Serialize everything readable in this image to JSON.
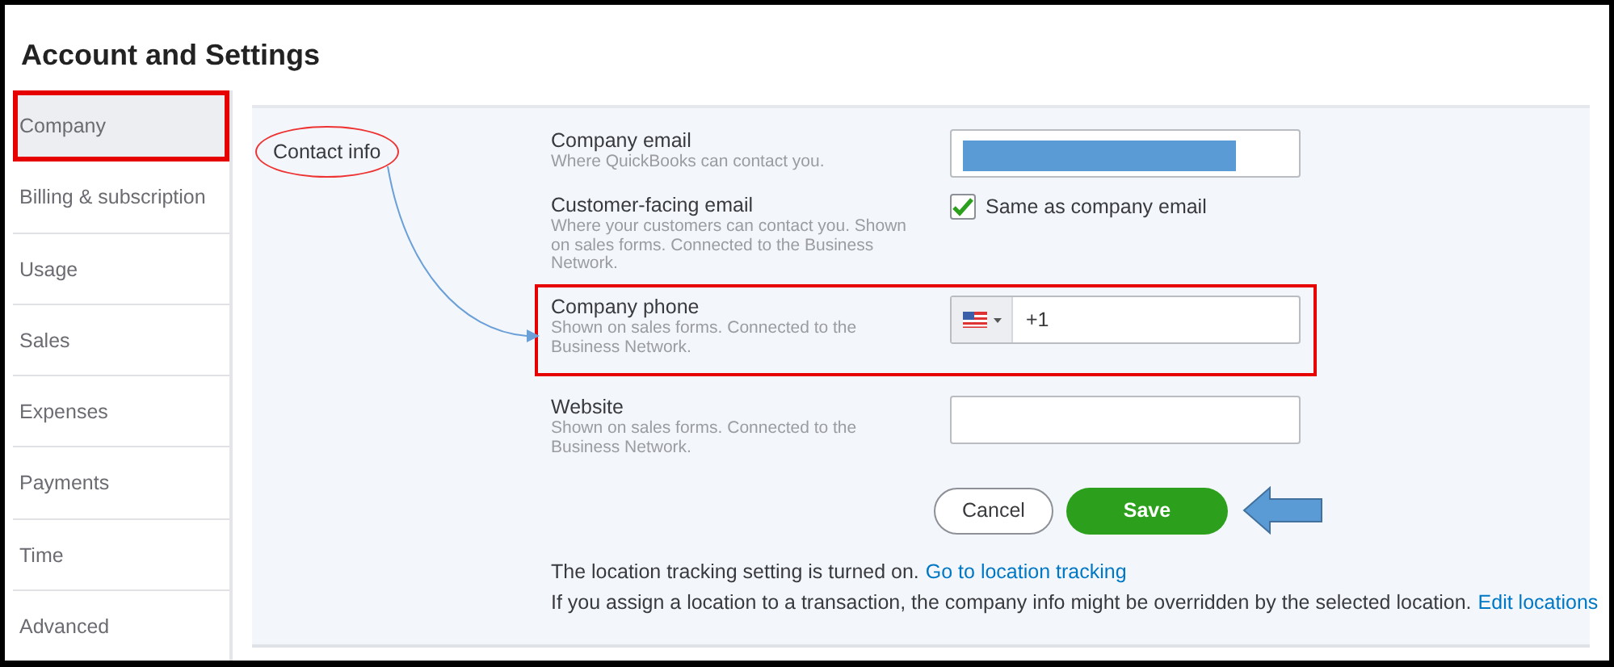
{
  "title": "Account and Settings",
  "sidebar": {
    "items": [
      {
        "label": "Company",
        "selected": true,
        "highlighted": true
      },
      {
        "label": "Billing & subscription",
        "selected": false,
        "highlighted": false
      },
      {
        "label": "Usage",
        "selected": false,
        "highlighted": false
      },
      {
        "label": "Sales",
        "selected": false,
        "highlighted": false
      },
      {
        "label": "Expenses",
        "selected": false,
        "highlighted": false
      },
      {
        "label": "Payments",
        "selected": false,
        "highlighted": false
      },
      {
        "label": "Time",
        "selected": false,
        "highlighted": false
      },
      {
        "label": "Advanced",
        "selected": false,
        "highlighted": false
      }
    ]
  },
  "section": {
    "label": "Contact info",
    "circled": true
  },
  "fields": [
    {
      "kind": "email",
      "label": "Company email",
      "hint": "Where QuickBooks can contact you.",
      "redacted": true,
      "highlighted": false
    },
    {
      "kind": "checkbox",
      "label": "Customer-facing email",
      "hint": "Where your customers can contact you. Shown on sales forms. Connected to the Business Network.",
      "option": "Same as company email",
      "checked": true,
      "highlighted": false
    },
    {
      "kind": "phone",
      "label": "Company phone",
      "hint": "Shown on sales forms. Connected to the Business Network.",
      "value": "+1",
      "highlighted": true
    },
    {
      "kind": "text",
      "label": "Website",
      "hint": "Shown on sales forms. Connected to the Business Network.",
      "highlighted": false
    }
  ],
  "buttons": [
    {
      "label": "Cancel",
      "kind": "secondary"
    },
    {
      "label": "Save",
      "kind": "primary",
      "pointed": true
    }
  ],
  "notes": [
    {
      "text": "The location tracking setting is turned on.",
      "link": "Go to location tracking"
    },
    {
      "text": "If you assign a location to a transaction, the company info might be overridden by the selected location.",
      "link": "Edit locations"
    }
  ]
}
